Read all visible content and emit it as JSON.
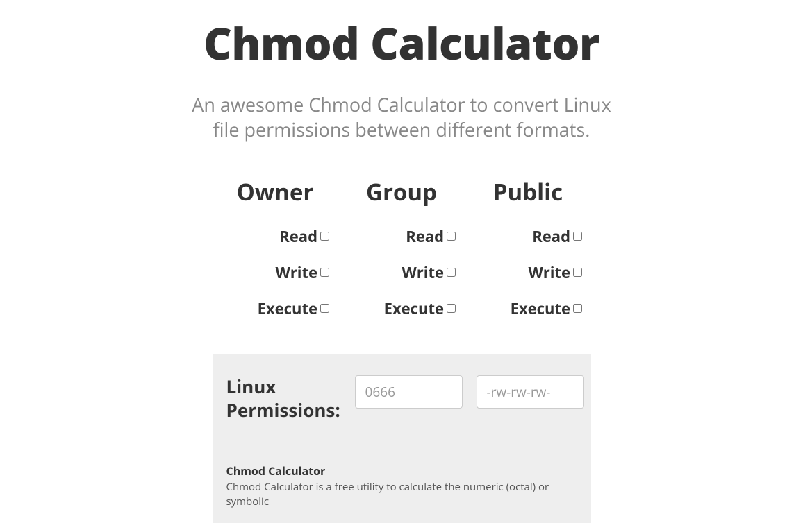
{
  "title": "Chmod Calculator",
  "subtitle": "An awesome Chmod Calculator to convert Linux file permissions between different formats.",
  "columns": {
    "owner": {
      "header": "Owner",
      "read": "Read",
      "write": "Write",
      "execute": "Execute"
    },
    "group": {
      "header": "Group",
      "read": "Read",
      "write": "Write",
      "execute": "Execute"
    },
    "public": {
      "header": "Public",
      "read": "Read",
      "write": "Write",
      "execute": "Execute"
    }
  },
  "results": {
    "label": "Linux Permissions:",
    "octal_placeholder": "0666",
    "octal_value": "",
    "symbolic_placeholder": "-rw-rw-rw-",
    "symbolic_value": ""
  },
  "description": {
    "heading": "Chmod Calculator",
    "body": "Chmod Calculator is a free utility to calculate the numeric (octal) or symbolic"
  }
}
